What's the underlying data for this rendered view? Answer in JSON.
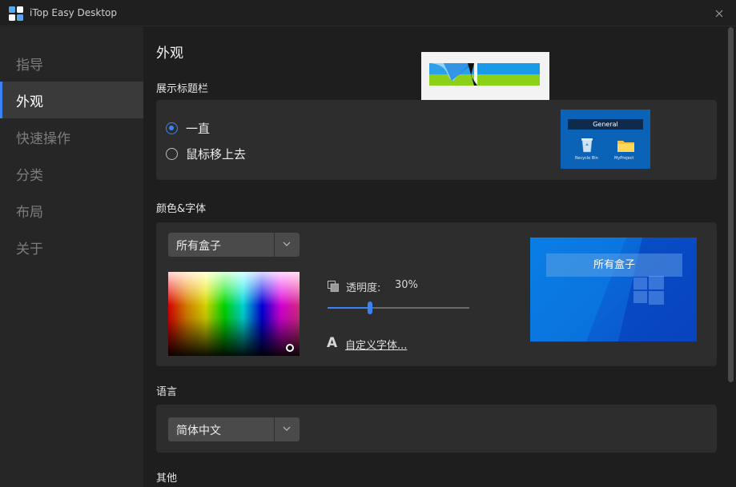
{
  "window": {
    "title": "iTop Easy Desktop"
  },
  "sidebar": {
    "items": [
      {
        "label": "指导"
      },
      {
        "label": "外观"
      },
      {
        "label": "快速操作"
      },
      {
        "label": "分类"
      },
      {
        "label": "布局"
      },
      {
        "label": "关于"
      }
    ],
    "active_index": 1
  },
  "main": {
    "page_title": "外观",
    "title_bar_section": {
      "title": "展示标题栏",
      "options": [
        {
          "label": "一直",
          "checked": true
        },
        {
          "label": "鼠标移上去",
          "checked": false
        }
      ],
      "preview": {
        "header": "General",
        "icons": [
          {
            "icon": "recycle-bin-icon",
            "label": "Recycle Bin"
          },
          {
            "icon": "folder-icon",
            "label": "MyProject"
          }
        ]
      }
    },
    "color_font_section": {
      "title": "颜色&字体",
      "scope_select": {
        "value": "所有盒子"
      },
      "opacity": {
        "label": "透明度:",
        "value_text": "30%",
        "value": 0.3
      },
      "font_link": "自定义字体...",
      "preview": {
        "box_label": "所有盒子"
      }
    },
    "language_section": {
      "title": "语言",
      "select": {
        "value": "简体中文"
      }
    },
    "other_section": {
      "title": "其他"
    }
  },
  "colors": {
    "accent": "#3b82f6",
    "sidebar_bg": "#262626",
    "sidebar_active_bg": "#3a3a3a",
    "panel_bg": "#2d2d2d",
    "main_bg": "#1e1e1e"
  }
}
